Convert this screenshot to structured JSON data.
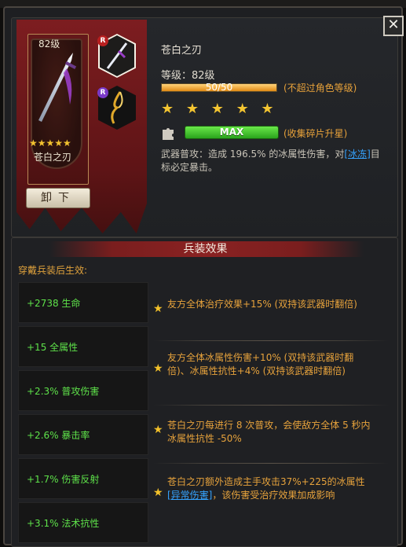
{
  "window": {
    "close_symbol": "✕"
  },
  "weapon": {
    "name": "苍白之刃",
    "level_short": "82级",
    "stars": "★★★★★",
    "unequip_label": "卸下",
    "title": "苍白之刃",
    "grade_label": "等级：82级",
    "grade_progress_text": "50/50",
    "grade_progress": 1.0,
    "grade_note": "(不超过角色等级)",
    "big_stars": "★ ★ ★ ★ ★",
    "fragment_status": "MAX",
    "fragment_note": "(收集碎片升星)",
    "desc_prefix": "武器普攻：造成 196.5% 的冰属性伤害，对",
    "desc_keyword": "[冰冻]",
    "desc_suffix": "目标必定暴击。",
    "slot1_badge": "R",
    "slot2_badge": "R"
  },
  "effects": {
    "section_title": "兵装效果",
    "subtitle": "穿戴兵装后生效:",
    "stats": [
      "+2738 生命",
      "+15 全属性",
      "+2.3% 普攻伤害",
      "+2.6% 暴击率",
      "+1.7% 伤害反射",
      "+3.1% 法术抗性"
    ],
    "passives": [
      {
        "text": "友方全体治疗效果+15% (双持该武器时翻倍)"
      },
      {
        "text": "友方全体冰属性伤害+10% (双持该武器时翻倍)、冰属性抗性+4% (双持该武器时翻倍)"
      },
      {
        "text": "苍白之刃每进行 8 次普攻，会使敌方全体 5 秒内冰属性抗性 -50%"
      },
      {
        "text_prefix": "苍白之刃额外造成主手攻击37%+225的冰属性",
        "keyword": "[异常伤害]",
        "text_suffix": "，该伤害受治疗效果加成影响"
      }
    ]
  },
  "colors": {
    "accent_orange": "#e8a23a",
    "stat_green": "#5ee24a",
    "banner_red": "#7d1d20",
    "keyword_blue": "#35a3ff"
  },
  "icons": [
    "close-icon",
    "sword-icon",
    "puzzle-icon",
    "star-icon",
    "gold-blade-icon"
  ]
}
